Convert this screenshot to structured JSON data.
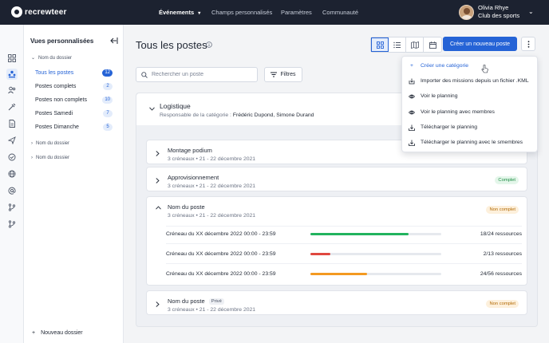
{
  "app": {
    "logo_text": "recrewteer"
  },
  "topnav": {
    "items": [
      {
        "label": "Événements",
        "has_dropdown": true
      },
      {
        "label": "Champs personnalisés"
      },
      {
        "label": "Paramètres"
      },
      {
        "label": "Communauté"
      }
    ]
  },
  "user": {
    "name": "Olivia Rhye",
    "club": "Club des sports"
  },
  "rail": {
    "icons": [
      "dashboard-icon",
      "team-icon",
      "users-icon",
      "tools-icon",
      "document-icon",
      "send-icon",
      "check-circle-icon",
      "globe-icon",
      "at-icon",
      "branch-icon",
      "branch-alt-icon"
    ]
  },
  "sidebar": {
    "title": "Vues personnalisées",
    "folders": [
      {
        "label": "Nom du dossier",
        "expanded": true,
        "items": [
          {
            "label": "Tous les postes",
            "count": "12",
            "active": true
          },
          {
            "label": "Postes complets",
            "count": "2"
          },
          {
            "label": "Postes non complets",
            "count": "10"
          },
          {
            "label": "Postes Samedi",
            "count": "7"
          },
          {
            "label": "Postes Dimanche",
            "count": "5"
          }
        ]
      },
      {
        "label": "Nom du dossier",
        "expanded": false
      },
      {
        "label": "Nom du dossier",
        "expanded": false
      }
    ],
    "new_folder": {
      "icon": "+",
      "label": "Nouveau dossier"
    }
  },
  "main": {
    "title": "Tous les postes",
    "view_buttons": [
      "grid-view-icon",
      "list-view-icon",
      "map-view-icon",
      "calendar-view-icon"
    ],
    "create_button": "Créer un nouveau poste",
    "search": {
      "placeholder": "Rechercher un poste",
      "value": ""
    },
    "filters_button": "Filtres"
  },
  "category": {
    "title": "Logistique",
    "manager_label": "Responsable de la catégorie :",
    "managers": "Frédéric Dupond, Simone Durand",
    "posts": [
      {
        "title": "Montage podium",
        "meta": "3 créneaux  •  21 - 22 décembre 2021",
        "status": "",
        "private": ""
      },
      {
        "title": "Approvisionnement",
        "meta": "3 créneaux  •  21 - 22 décembre 2021",
        "status": "Complet",
        "private": ""
      },
      {
        "title": "Nom du poste",
        "meta": "3 créneaux  •  21 - 22 décembre 2021",
        "status": "Non complet",
        "private": "",
        "expanded": true,
        "slots": [
          {
            "label": "Créneau du XX décembre 2022 00:00 - 23:59",
            "resources": "18/24 ressources",
            "fill": 0.75,
            "color": "#22b35e"
          },
          {
            "label": "Créneau du XX décembre 2022 00:00 - 23:59",
            "resources": "2/13 ressources",
            "fill": 0.154,
            "color": "#e0473f"
          },
          {
            "label": "Créneau du XX décembre 2022 00:00 - 23:59",
            "resources": "24/56 ressources",
            "fill": 0.43,
            "color": "#f39a21"
          }
        ]
      },
      {
        "title": "Nom du poste",
        "meta": "3 créneaux  •  21 - 22 décembre 2021",
        "status": "Non complet",
        "private": "Privé"
      }
    ]
  },
  "dropdown": {
    "items": [
      {
        "icon": "plus-icon",
        "label": "Créer une catégorie",
        "highlight": true
      },
      {
        "icon": "import-icon",
        "label": "Importer des missions depuis un fichier .KML"
      },
      {
        "icon": "eye-icon",
        "label": "Voir le planning"
      },
      {
        "icon": "eye-icon",
        "label": "Voir le planning avec membres"
      },
      {
        "icon": "download-icon",
        "label": "Télécharger le planning"
      },
      {
        "icon": "download-icon",
        "label": "Télécharger le planning avec le smembres"
      }
    ]
  },
  "colors": {
    "primary": "#2563d6",
    "topbar": "#1c2230",
    "complete": "#1f8d45",
    "incomplete": "#b36b06"
  }
}
